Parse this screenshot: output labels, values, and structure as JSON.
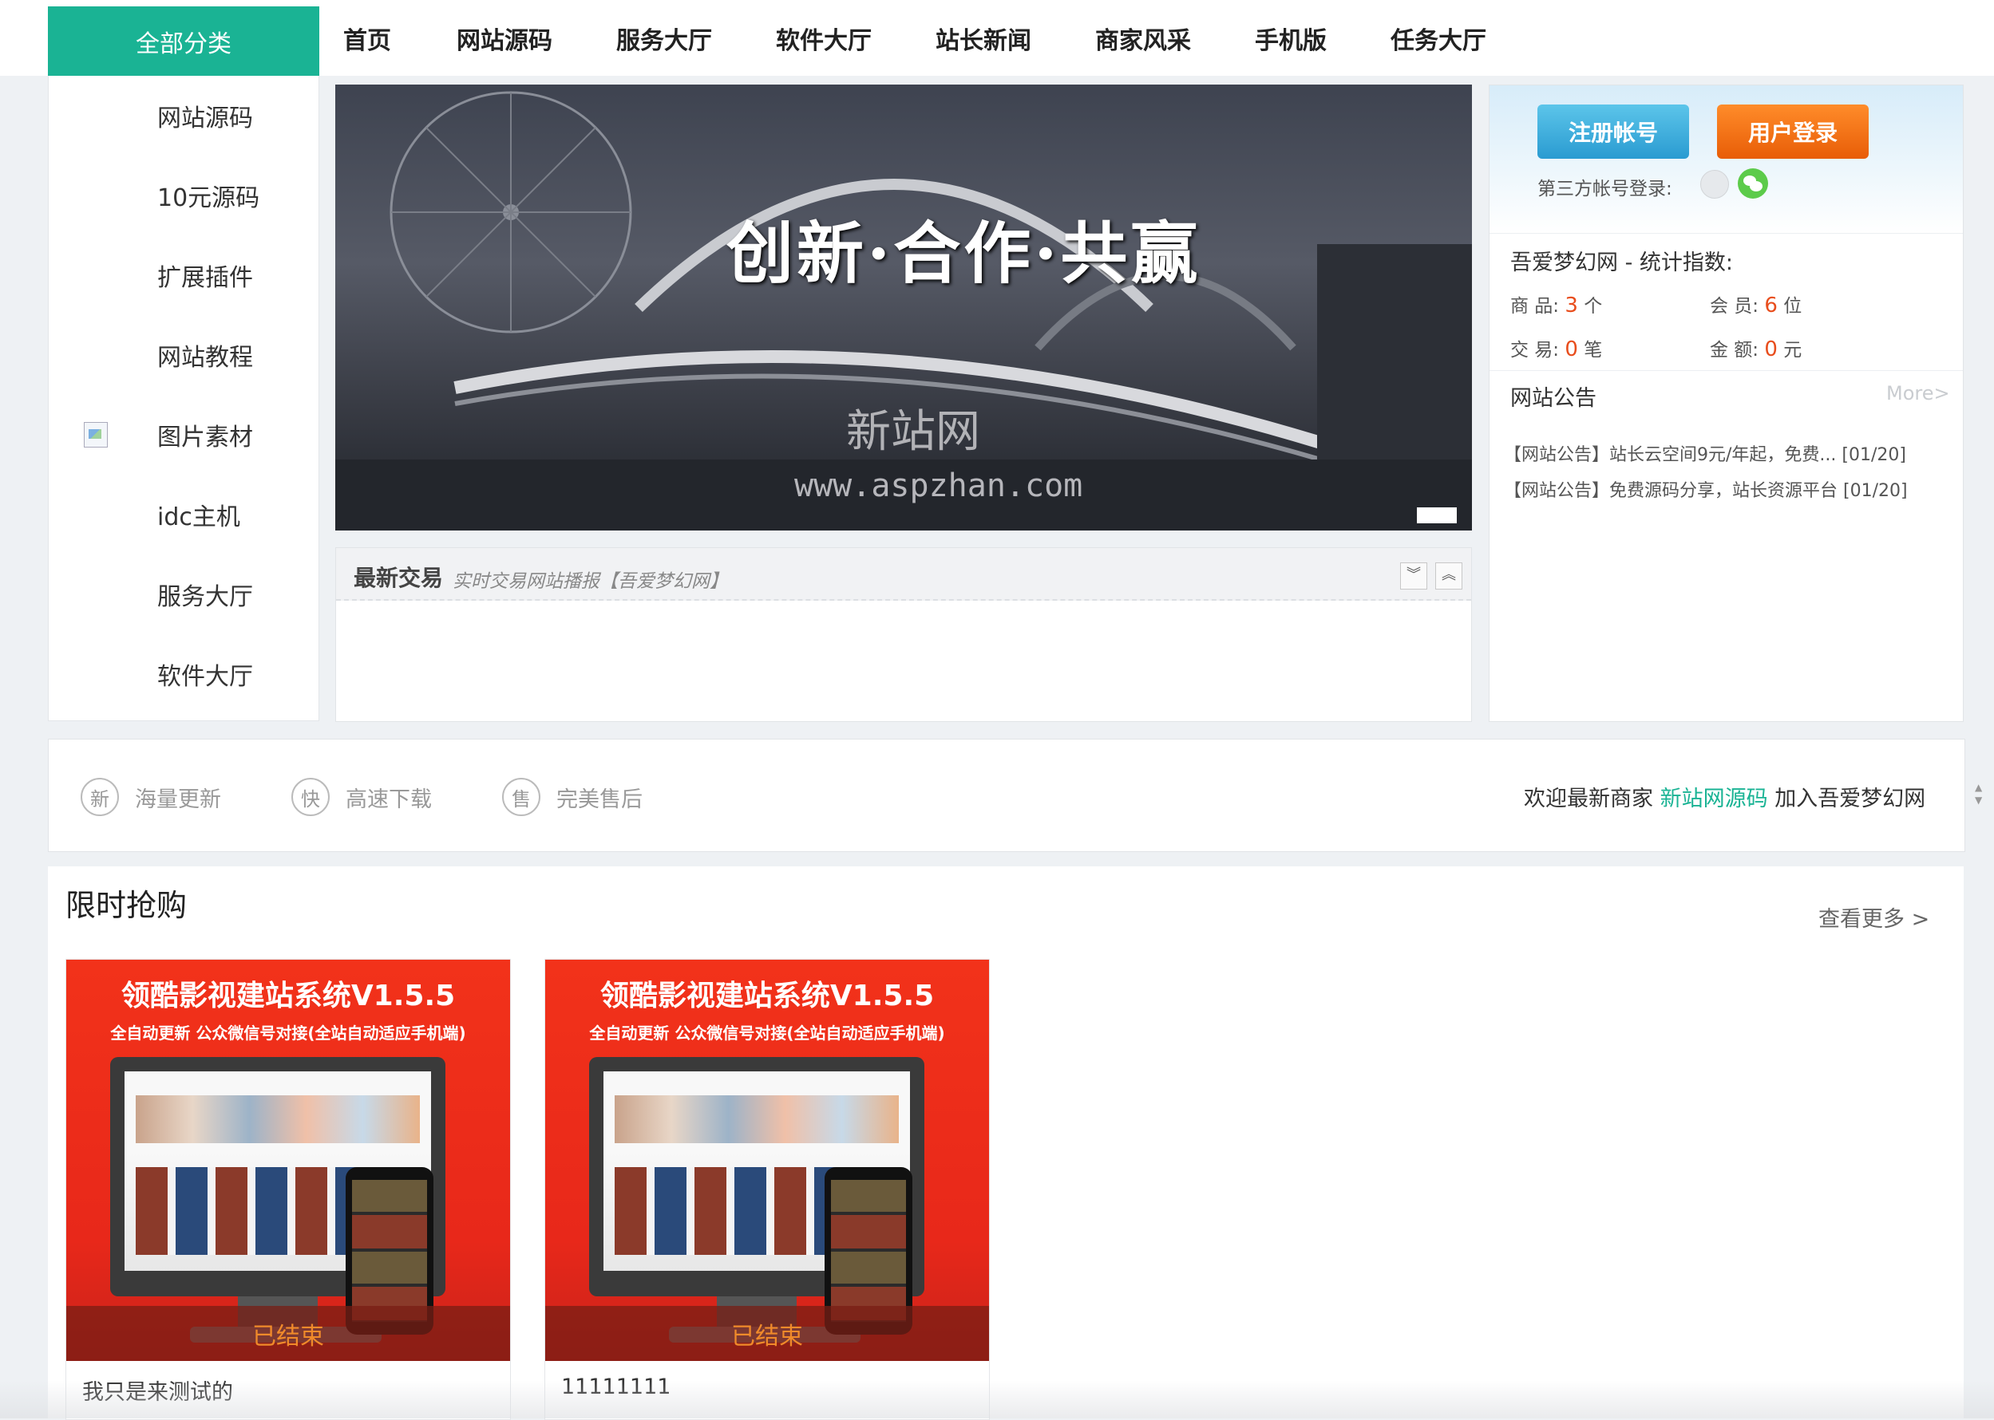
{
  "header": {
    "all_categories": "全部分类",
    "nav": [
      "首页",
      "网站源码",
      "服务大厅",
      "软件大厅",
      "站长新闻",
      "商家风采",
      "手机版",
      "任务大厅"
    ]
  },
  "sidebar": {
    "items": [
      "网站源码",
      "10元源码",
      "扩展插件",
      "网站教程",
      "图片素材",
      "idc主机",
      "服务大厅",
      "软件大厅"
    ]
  },
  "banner": {
    "title": "创新·合作·共赢",
    "watermark": "新站网",
    "watermark_url": "www.aspzhan.com"
  },
  "trades": {
    "title": "最新交易",
    "subtitle": "实时交易网站播报【吾爱梦幻网】",
    "down_icon": "chevron-double-down-icon",
    "up_icon": "chevron-double-up-icon"
  },
  "user": {
    "register": "注册帐号",
    "login": "用户登录",
    "third_party": "第三方帐号登录:",
    "stats_title": "吾爱梦幻网 - 统计指数:",
    "goods_label": "商 品:",
    "goods_value": "3",
    "goods_unit": "个",
    "members_label": "会 员:",
    "members_value": "6",
    "members_unit": "位",
    "trades_label": "交 易:",
    "trades_value": "0",
    "trades_unit": "笔",
    "amount_label": "金 额:",
    "amount_value": "0",
    "amount_unit": "元",
    "notice_title": "网站公告",
    "more": "More>",
    "notices": [
      "【网站公告】站长云空间9元/年起，免费... [01/20]",
      "【网站公告】免费源码分享，站长资源平台 [01/20]"
    ]
  },
  "features": {
    "items": [
      {
        "icon": "新",
        "text": "海量更新"
      },
      {
        "icon": "快",
        "text": "高速下载"
      },
      {
        "icon": "售",
        "text": "完美售后"
      }
    ],
    "welcome_prefix": "欢迎最新商家",
    "welcome_shop": "新站网源码",
    "welcome_suffix": "加入吾爱梦幻网"
  },
  "flash_sale": {
    "title": "限时抢购",
    "view_more": "查看更多 >",
    "products": [
      {
        "img_title": "领酷影视建站系统V1.5.5",
        "img_sub": "全自动更新  公众微信号对接(全站自动适应手机端)",
        "status": "已结束",
        "name": "我只是来测试的"
      },
      {
        "img_title": "领酷影视建站系统V1.5.5",
        "img_sub": "全自动更新  公众微信号对接(全站自动适应手机端)",
        "status": "已结束",
        "name": "11111111"
      }
    ]
  },
  "colors": {
    "accent": "#1ab394",
    "orange": "#e85d07",
    "blue": "#2a9bd1",
    "highlight": "#e84d1c"
  }
}
